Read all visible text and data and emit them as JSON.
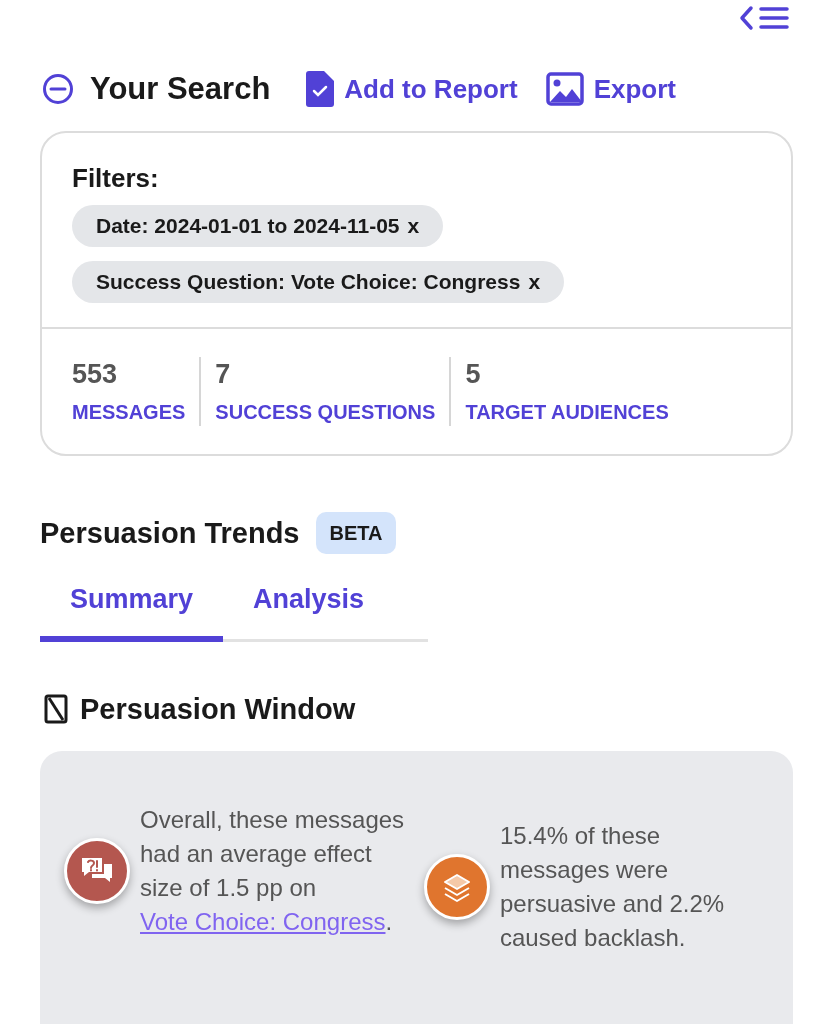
{
  "header": {
    "title": "Your Search",
    "actions": [
      {
        "label": "Add to Report",
        "kind": "report"
      },
      {
        "label": "Export",
        "kind": "image"
      }
    ]
  },
  "filters": {
    "label": "Filters:",
    "chips": [
      {
        "label": "Date: 2024-01-01 to 2024-11-05",
        "remove": "x"
      },
      {
        "label": "Success Question: Vote Choice: Congress",
        "remove": "x"
      }
    ]
  },
  "stats": [
    {
      "value": "553",
      "label": "MESSAGES"
    },
    {
      "value": "7",
      "label": "SUCCESS QUESTIONS"
    },
    {
      "value": "5",
      "label": "TARGET AUDIENCES"
    }
  ],
  "section": {
    "title": "Persuasion Trends",
    "badge": "BETA"
  },
  "tabs": [
    {
      "label": "Summary",
      "selected": true
    },
    {
      "label": "Analysis",
      "selected": false
    }
  ],
  "window_title": "Persuasion Window",
  "insights": [
    {
      "kind": "effect",
      "color": "#b4574f",
      "text": "Overall, these messages had an average effect size of 1.5 pp on ",
      "link": "Vote Choice: Congress",
      "after": "."
    },
    {
      "kind": "share",
      "color": "#e0752e",
      "text": "15.4% of these messages were persuasive and 2.2% caused backlash."
    }
  ]
}
